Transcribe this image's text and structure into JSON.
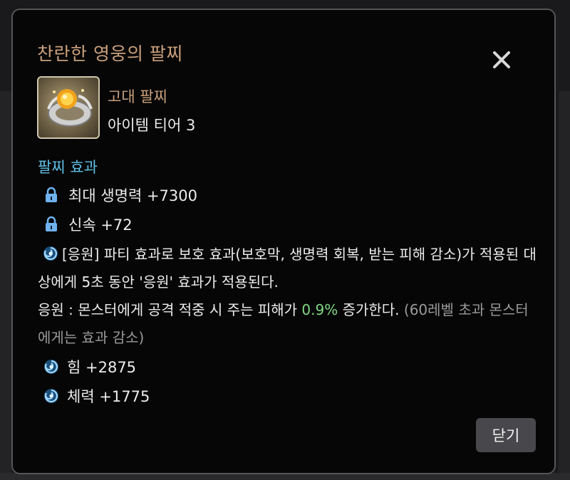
{
  "modal": {
    "title": "찬란한 영웅의 팔찌",
    "item_type": "고대 팔찌",
    "item_tier": "아이템 티어 3",
    "section_title": "팔찌 효과",
    "stats_locked": [
      {
        "label": "최대 생명력 +7300",
        "icon": "lock-icon"
      },
      {
        "label": "신속 +72",
        "icon": "lock-icon"
      }
    ],
    "effect": {
      "icon": "swirl-icon",
      "line1": "[응원] 파티 효과로 보호 효과(보호막, 생명력 회복, 받는 피해 감소)가 적용된 대상에게 5초 동안 '응원' 효과가 적용된다.",
      "line2_prefix": "응원 : 몬스터에게 공격 적중 시 주는 피해가 ",
      "line2_value": "0.9%",
      "line2_suffix": " 증가한다. ",
      "line2_note": "(60레벨 초과 몬스터에게는 효과 감소)"
    },
    "stats_random": [
      {
        "label": "힘 +2875",
        "icon": "swirl-icon"
      },
      {
        "label": "체력 +1775",
        "icon": "swirl-icon"
      }
    ],
    "close_button": "닫기",
    "close_icon": "close-icon"
  },
  "colors": {
    "title": "#c9a07d",
    "section": "#5ec0e6",
    "highlight": "#7fd982",
    "note": "#9a9a9a"
  }
}
